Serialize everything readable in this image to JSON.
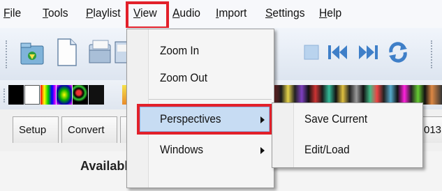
{
  "menubar": {
    "items": [
      {
        "label": "File",
        "key": "F",
        "rest": "ile"
      },
      {
        "label": "Tools",
        "key": "T",
        "rest": "ools"
      },
      {
        "label": "Playlist",
        "key": "P",
        "rest": "laylist"
      },
      {
        "label": "View",
        "key": "V",
        "rest": "iew"
      },
      {
        "label": "Audio",
        "key": "A",
        "rest": "udio"
      },
      {
        "label": "Import",
        "key": "I",
        "rest": "mport"
      },
      {
        "label": "Settings",
        "key": "S",
        "rest": "ettings"
      },
      {
        "label": "Help",
        "key": "H",
        "rest": "elp"
      }
    ]
  },
  "view_menu": {
    "items": [
      "Zoom In",
      "Zoom Out",
      "Perspectives",
      "Windows"
    ]
  },
  "perspectives_submenu": {
    "items": [
      "Save Current",
      "Edit/Load"
    ]
  },
  "tabs": [
    "Setup",
    "Convert",
    "013"
  ],
  "panel": {
    "heading": "Available Files"
  },
  "colors": {
    "highlight_box": "#e2202a",
    "menu_hover": "#c7dcf3"
  }
}
